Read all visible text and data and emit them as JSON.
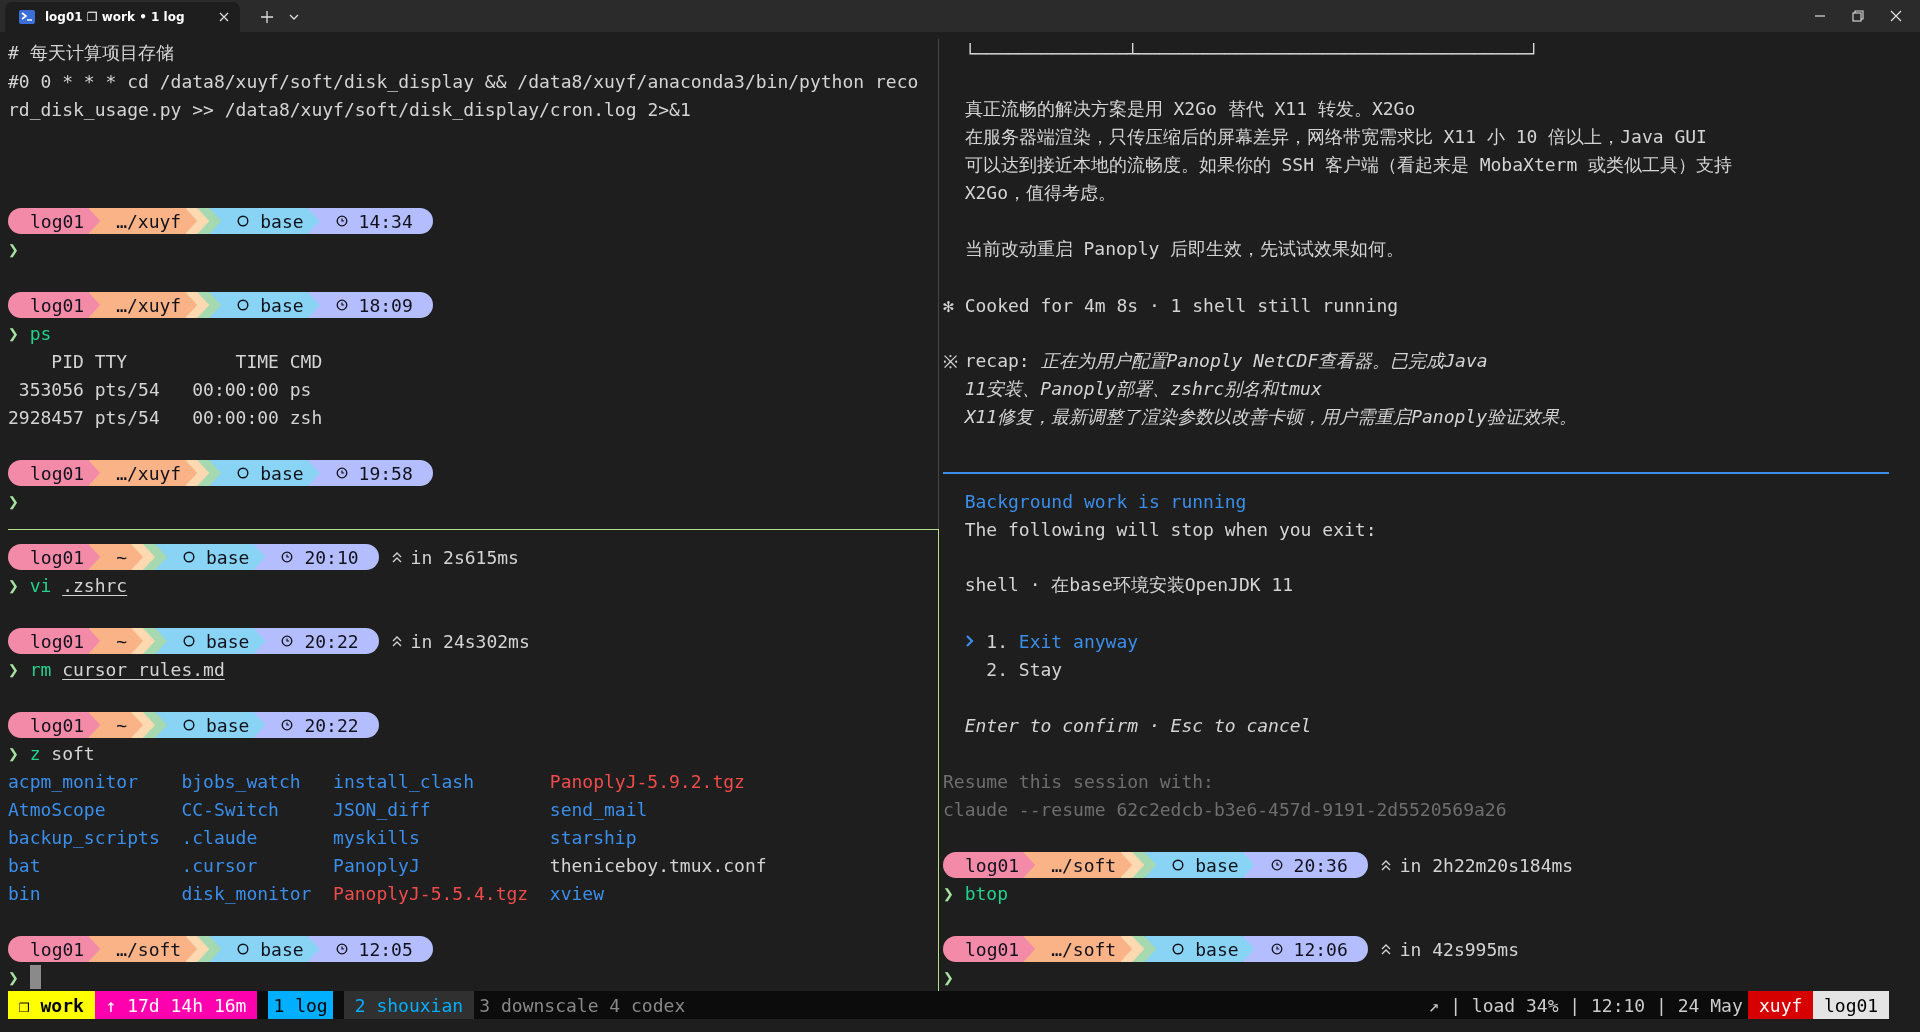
{
  "tab_bar": {
    "tabs": [
      {
        "title": "log01 ❐ work • 1 log",
        "selected": true
      }
    ]
  },
  "panes": {
    "left_top": {
      "lines": [
        {
          "kind": "text",
          "text": "# 每天计算项目存储"
        },
        {
          "kind": "text",
          "text": "#0 0 * * * cd /data8/xuyf/soft/disk_display && /data8/xuyf/anaconda3/bin/python reco"
        },
        {
          "kind": "text",
          "text": "rd_disk_usage.py >> /data8/xuyf/soft/disk_display/cron.log 2>&1"
        },
        {
          "kind": "blank"
        },
        {
          "kind": "blank"
        },
        {
          "kind": "blank"
        },
        {
          "kind": "prompt",
          "host": "log01",
          "path": "…/xuyf",
          "env": "base",
          "time": "14:34"
        },
        {
          "kind": "command",
          "symbol": "❯"
        },
        {
          "kind": "blank"
        },
        {
          "kind": "prompt",
          "host": "log01",
          "path": "…/xuyf",
          "env": "base",
          "time": "18:09"
        },
        {
          "kind": "command",
          "symbol": "❯",
          "command": "ps"
        },
        {
          "kind": "text",
          "text": "    PID TTY          TIME CMD"
        },
        {
          "kind": "text",
          "text": " 353056 pts/54   00:00:00 ps"
        },
        {
          "kind": "text",
          "text": "2928457 pts/54   00:00:00 zsh"
        },
        {
          "kind": "blank"
        },
        {
          "kind": "prompt",
          "host": "log01",
          "path": "…/xuyf",
          "env": "base",
          "time": "19:58"
        },
        {
          "kind": "command",
          "symbol": "❯"
        }
      ]
    },
    "left_bottom": {
      "lines": [
        {
          "kind": "prompt",
          "host": "log01",
          "path": "~",
          "env": "base",
          "time": "20:10",
          "duration": "in 2s615ms"
        },
        {
          "kind": "command",
          "symbol": "❯",
          "command": "vi",
          "argument": ".zshrc",
          "argument_is_path": true
        },
        {
          "kind": "blank"
        },
        {
          "kind": "prompt",
          "host": "log01",
          "path": "~",
          "env": "base",
          "time": "20:22",
          "duration": "in 24s302ms"
        },
        {
          "kind": "command",
          "symbol": "❯",
          "command": "rm",
          "argument": "cursor_rules.md",
          "argument_is_path": true
        },
        {
          "kind": "blank"
        },
        {
          "kind": "prompt",
          "host": "log01",
          "path": "~",
          "env": "base",
          "time": "20:22"
        },
        {
          "kind": "command",
          "symbol": "❯",
          "command": "z",
          "argument": "soft",
          "argument_is_path": false
        },
        {
          "kind": "listing",
          "columns": [
            [
              {
                "name": "acpm_monitor",
                "kind": "directory"
              },
              {
                "name": "AtmoScope",
                "kind": "directory"
              },
              {
                "name": "backup_scripts",
                "kind": "directory"
              },
              {
                "name": "bat",
                "kind": "directory"
              },
              {
                "name": "bin",
                "kind": "directory"
              }
            ],
            [
              {
                "name": "bjobs_watch",
                "kind": "directory"
              },
              {
                "name": "CC-Switch",
                "kind": "directory"
              },
              {
                "name": ".claude",
                "kind": "directory"
              },
              {
                "name": ".cursor",
                "kind": "directory"
              },
              {
                "name": "disk_monitor",
                "kind": "directory"
              }
            ],
            [
              {
                "name": "install_clash",
                "kind": "directory"
              },
              {
                "name": "JSON_diff",
                "kind": "directory"
              },
              {
                "name": "myskills",
                "kind": "directory"
              },
              {
                "name": "PanoplyJ",
                "kind": "directory"
              },
              {
                "name": "PanoplyJ-5.5.4.tgz",
                "kind": "archive"
              }
            ],
            [
              {
                "name": "PanoplyJ-5.9.2.tgz",
                "kind": "archive"
              },
              {
                "name": "send_mail",
                "kind": "directory"
              },
              {
                "name": "starship",
                "kind": "directory"
              },
              {
                "name": "theniceboy.tmux.conf",
                "kind": "file"
              },
              {
                "name": "xview",
                "kind": "directory"
              }
            ]
          ]
        },
        {
          "kind": "blank"
        },
        {
          "kind": "prompt",
          "host": "log01",
          "path": "…/soft",
          "env": "base",
          "time": "12:05"
        },
        {
          "kind": "command",
          "symbol": "❯",
          "cursor": true
        }
      ]
    },
    "right": {
      "lines": [
        {
          "kind": "message",
          "text": "└──────────────┴────────────────────────────────────┘"
        },
        {
          "kind": "blank"
        },
        {
          "kind": "message",
          "text": "真正流畅的解决方案是用 X2Go 替代 X11 转发。X2Go"
        },
        {
          "kind": "message",
          "text": "在服务器端渲染，只传压缩后的屏幕差异，网络带宽需求比 X11 小 10 倍以上，Java GUI"
        },
        {
          "kind": "message",
          "text": "可以达到接近本地的流畅度。如果你的 SSH 客户端（看起来是 MobaXterm 或类似工具）支持"
        },
        {
          "kind": "message",
          "text": "X2Go，值得考虑。"
        },
        {
          "kind": "blank"
        },
        {
          "kind": "message",
          "text": "当前改动重启 Panoply 后即生效，先试试效果如何。"
        },
        {
          "kind": "blank"
        },
        {
          "kind": "message",
          "marker": "✻",
          "text": "Cooked for 4m 8s · 1 shell still running"
        },
        {
          "kind": "blank"
        },
        {
          "kind": "message",
          "marker": "※",
          "text": "recap: *正在为用户配置Panoply NetCDF查看器。已完成Java*"
        },
        {
          "kind": "note",
          "text": "11安装、Panoply部署、zshrc别名和tmux"
        },
        {
          "kind": "note",
          "text": "X11修复，最新调整了渲染参数以改善卡顿，用户需重启Panoply验证效果。"
        },
        {
          "kind": "blank"
        },
        {
          "kind": "rule"
        },
        {
          "kind": "heading",
          "text": "Background work is running"
        },
        {
          "kind": "message",
          "text": "The following will stop when you exit:"
        },
        {
          "kind": "blank"
        },
        {
          "kind": "message",
          "text": "shell · 在base环境安装OpenJDK 11"
        },
        {
          "kind": "blank"
        },
        {
          "kind": "option",
          "number": "1.",
          "label": "Exit anyway",
          "selected": true
        },
        {
          "kind": "option",
          "number": "2.",
          "label": "Stay",
          "selected": false
        },
        {
          "kind": "blank"
        },
        {
          "kind": "note",
          "text": "Enter to confirm · Esc to cancel"
        },
        {
          "kind": "blank"
        },
        {
          "kind": "hint",
          "text": "Resume this session with:"
        },
        {
          "kind": "hint",
          "text": "claude --resume 62c2edcb-b3e6-457d-9191-2d5520569a26"
        },
        {
          "kind": "blank"
        },
        {
          "kind": "prompt",
          "host": "log01",
          "path": "…/soft",
          "env": "base",
          "time": "20:36",
          "duration": "in 2h22m20s184ms"
        },
        {
          "kind": "command",
          "symbol": "❯",
          "command": "btop"
        },
        {
          "kind": "blank"
        },
        {
          "kind": "prompt",
          "host": "log01",
          "path": "…/soft",
          "env": "base",
          "time": "12:06",
          "duration": "in 42s995ms"
        },
        {
          "kind": "command",
          "symbol": "❯"
        }
      ]
    }
  },
  "status_bar": {
    "left": [
      {
        "kind": "session",
        "text": "❐ work"
      },
      {
        "kind": "uptime",
        "text": "↑ 17d 14h 16m"
      },
      {
        "kind": "window",
        "text": "1 log",
        "selected": true,
        "last": false
      },
      {
        "kind": "window",
        "text": "2 shouxian",
        "selected": false,
        "last": true
      },
      {
        "kind": "window",
        "text": "3 downscale",
        "selected": false,
        "last": false
      },
      {
        "kind": "window",
        "text": "4 codex",
        "selected": false,
        "last": false
      }
    ],
    "right": [
      {
        "kind": "plain",
        "text": "↗"
      },
      {
        "kind": "plain",
        "text": "| load 34% | 12:10 | 24 May"
      },
      {
        "kind": "user",
        "text": "xuyf"
      },
      {
        "kind": "host",
        "text": "log01"
      }
    ]
  }
}
